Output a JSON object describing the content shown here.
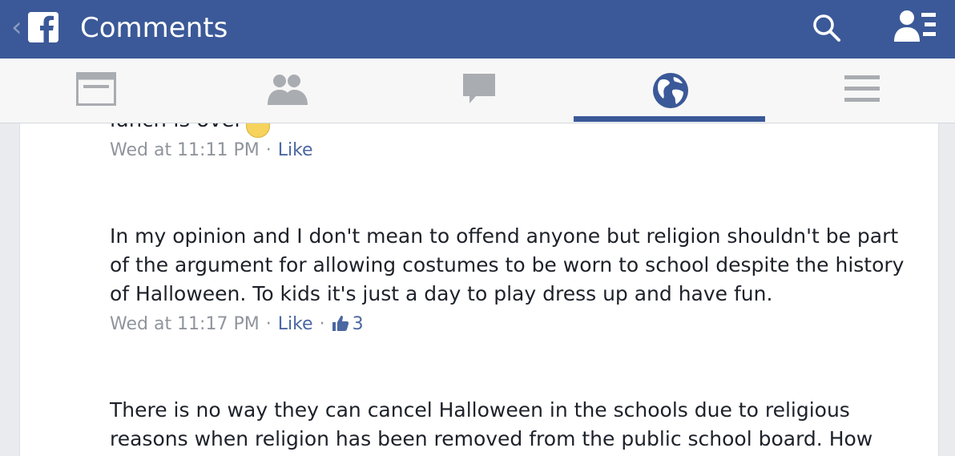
{
  "header": {
    "back_glyph": "‹",
    "title": "Comments"
  },
  "icons": {
    "search": "search-icon",
    "friend_requests": "friend-requests-icon",
    "news_feed": "news-feed-icon",
    "groups": "friends-icon",
    "messages": "messages-icon",
    "globe": "globe-icon",
    "menu": "menu-icon"
  },
  "tabs": [
    {
      "name": "news-feed",
      "active": false
    },
    {
      "name": "friends",
      "active": false
    },
    {
      "name": "messages",
      "active": false
    },
    {
      "name": "notifications",
      "active": true
    },
    {
      "name": "menu",
      "active": false
    }
  ],
  "comments": [
    {
      "partial_text": "lunch is over",
      "time": "Wed at 11:11 PM",
      "like_label": "Like"
    },
    {
      "text": "In my opinion and I don't mean to offend anyone but religion shouldn't be part of the argument for allowing costumes to be worn to school despite the history of Halloween. To kids it's just a day to play dress up and have fun.",
      "time": "Wed at 11:17 PM",
      "like_label": "Like",
      "likes": "3"
    },
    {
      "text": "There is no way they can cancel Halloween in the schools due to religious reasons when religion has been removed from the public school board.  How"
    }
  ],
  "colors": {
    "brand": "#3b5998",
    "link": "#4b67a1",
    "meta": "#90949c",
    "text": "#1d2129"
  }
}
